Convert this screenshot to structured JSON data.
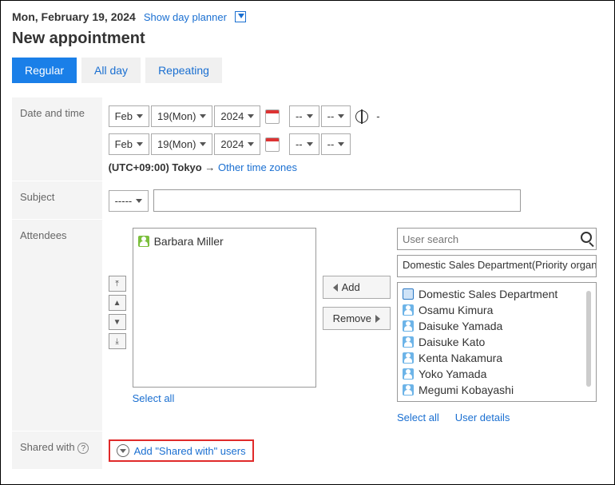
{
  "header": {
    "date": "Mon, February 19, 2024",
    "show_planner": "Show day planner"
  },
  "page_title": "New appointment",
  "tabs": {
    "regular": "Regular",
    "allday": "All day",
    "repeating": "Repeating"
  },
  "labels": {
    "date_time": "Date and time",
    "subject": "Subject",
    "attendees": "Attendees",
    "shared_with": "Shared with"
  },
  "datetime": {
    "month": "Feb",
    "day": "19(Mon)",
    "year": "2024",
    "hour": "--",
    "minute": "--",
    "tz_label": "(UTC+09:00) Tokyo",
    "tz_arrow": "→",
    "tz_link": "Other time zones",
    "dash": "-"
  },
  "subject": {
    "dropdown": "-----",
    "value": ""
  },
  "attendees": {
    "selected": [
      {
        "name": "Barbara Miller"
      }
    ],
    "add_btn": "Add",
    "remove_btn": "Remove",
    "search_placeholder": "User search",
    "org_selected": "Domestic Sales Department(Priority organization)",
    "candidates": [
      {
        "type": "org",
        "name": "Domestic Sales Department"
      },
      {
        "type": "user",
        "name": "Osamu Kimura"
      },
      {
        "type": "user",
        "name": "Daisuke Yamada"
      },
      {
        "type": "user",
        "name": "Daisuke Kato"
      },
      {
        "type": "user",
        "name": "Kenta Nakamura"
      },
      {
        "type": "user",
        "name": "Yoko Yamada"
      },
      {
        "type": "user",
        "name": "Megumi Kobayashi"
      }
    ],
    "select_all": "Select all",
    "select_all_right": "Select all",
    "user_details": "User details"
  },
  "shared": {
    "add_link": "Add \"Shared with\" users"
  }
}
